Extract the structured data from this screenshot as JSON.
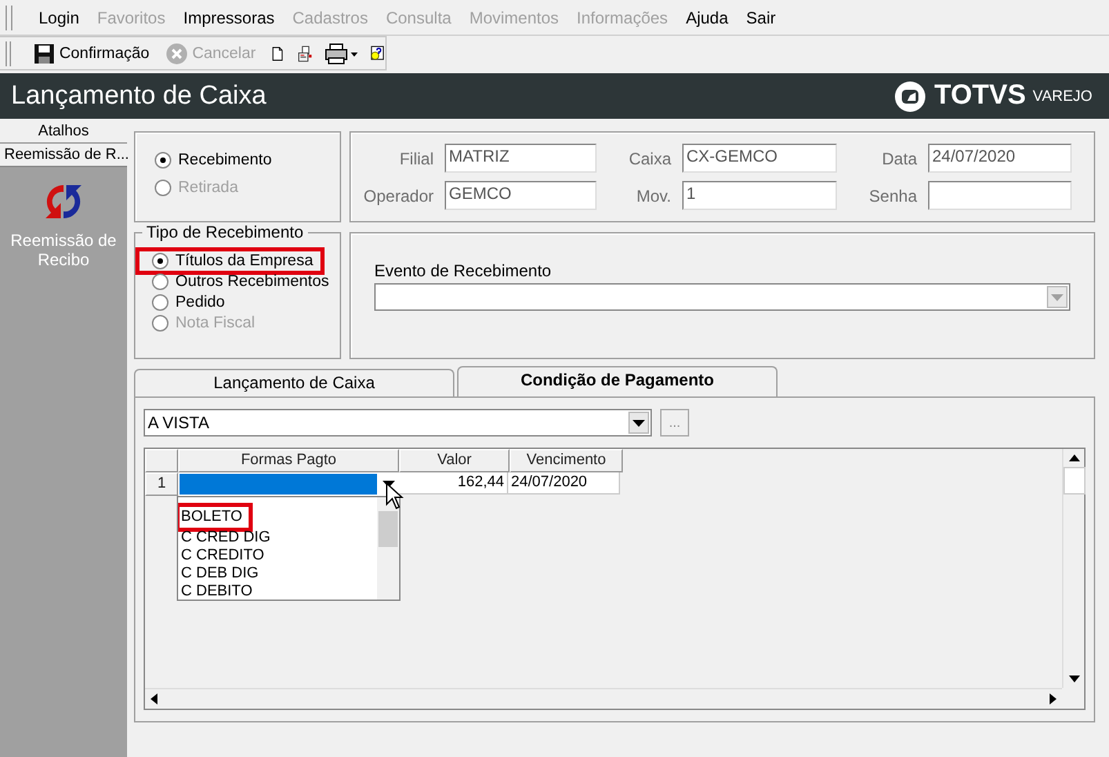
{
  "menu": [
    {
      "label": "Login",
      "disabled": false
    },
    {
      "label": "Favoritos",
      "disabled": true
    },
    {
      "label": "Impressoras",
      "disabled": false
    },
    {
      "label": "Cadastros",
      "disabled": true
    },
    {
      "label": "Consulta",
      "disabled": true
    },
    {
      "label": "Movimentos",
      "disabled": true
    },
    {
      "label": "Informações",
      "disabled": true
    },
    {
      "label": "Ajuda",
      "disabled": false
    },
    {
      "label": "Sair",
      "disabled": false
    }
  ],
  "toolbar": [
    {
      "kind": "save",
      "label": "Confirmação",
      "disabled": false
    },
    {
      "kind": "cancel",
      "label": "Cancelar",
      "disabled": true
    },
    {
      "kind": "new"
    },
    {
      "kind": "open"
    },
    {
      "kind": "print"
    },
    {
      "kind": "help"
    }
  ],
  "title": "Lançamento de Caixa",
  "brand": {
    "name": "TOTVS",
    "suffix": "VAREJO"
  },
  "sidebar": {
    "header": "Atalhos",
    "tab": "Reemissão de R...",
    "shortcut": "Reemissão de Recibo"
  },
  "operation": [
    {
      "label": "Recebimento",
      "selected": true,
      "disabled": false
    },
    {
      "label": "Retirada",
      "selected": false,
      "disabled": true
    }
  ],
  "fields": [
    {
      "label": "Filial",
      "value": "MATRIZ"
    },
    {
      "label": "Caixa",
      "value": "CX-GEMCO"
    },
    {
      "label": "Data",
      "value": "24/07/2020"
    },
    {
      "label": "Operador",
      "value": "GEMCO"
    },
    {
      "label": "Mov.",
      "value": "1"
    },
    {
      "label": "Senha"
    }
  ],
  "receipt_type": {
    "title": "Tipo de Recebimento",
    "options": [
      {
        "label": "Títulos da Empresa",
        "selected": true,
        "disabled": false,
        "highlighted": true
      },
      {
        "label": "Outros Recebimentos",
        "selected": false,
        "disabled": false,
        "highlighted": false
      },
      {
        "label": "Pedido",
        "selected": false,
        "disabled": false,
        "highlighted": false
      },
      {
        "label": "Nota Fiscal",
        "selected": false,
        "disabled": true,
        "highlighted": false
      }
    ]
  },
  "event": {
    "label": "Evento de Recebimento"
  },
  "tabs": [
    {
      "label": "Lançamento de Caixa",
      "selected": false
    },
    {
      "label": "Condição de Pagamento",
      "selected": true
    }
  ],
  "condition": {
    "value": "A VISTA",
    "button": "..."
  },
  "grid": {
    "columns": [
      "Formas Pagto",
      "Valor",
      "Vencimento"
    ],
    "rows": [
      {
        "number": "1",
        "value": "162,44",
        "due": "24/07/2020",
        "selected": true
      }
    ]
  },
  "dropdown": {
    "options": [
      {
        "label": "BOLETO",
        "highlighted": true
      },
      {
        "label": "C CRED DIG",
        "highlighted": false
      },
      {
        "label": "C CREDITO",
        "highlighted": false
      },
      {
        "label": "C DEB DIG",
        "highlighted": false
      },
      {
        "label": "C DEBITO",
        "highlighted": false
      }
    ]
  }
}
